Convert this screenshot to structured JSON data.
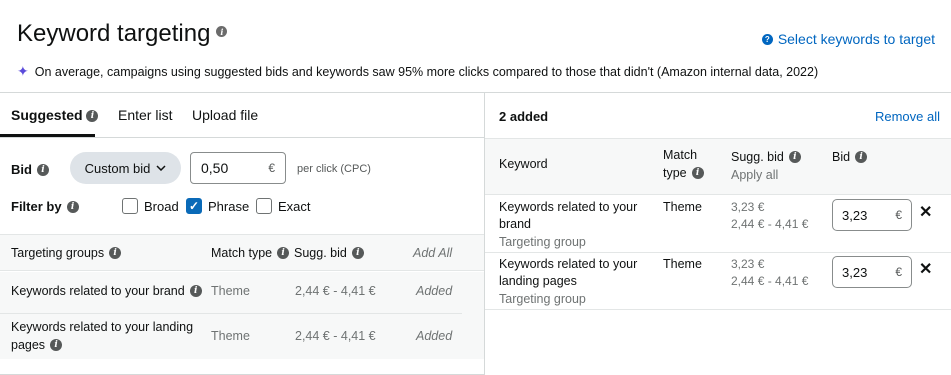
{
  "header": {
    "title": "Keyword targeting",
    "select_link": "Select keywords to target",
    "notice": "On average, campaigns using suggested bids and keywords saw 95% more clicks compared to those that didn't (Amazon internal data, 2022)"
  },
  "tabs": [
    {
      "label": "Suggested"
    },
    {
      "label": "Enter list"
    },
    {
      "label": "Upload file"
    }
  ],
  "bid": {
    "label": "Bid",
    "dropdown": "Custom bid",
    "value": "0,50",
    "currency": "€",
    "per_click": "per click (CPC)"
  },
  "filter": {
    "label": "Filter by",
    "options": [
      {
        "label": "Broad",
        "checked": false
      },
      {
        "label": "Phrase",
        "checked": true
      },
      {
        "label": "Exact",
        "checked": false
      }
    ]
  },
  "targeting_table": {
    "headers": {
      "group": "Targeting groups",
      "match": "Match type",
      "sugg": "Sugg. bid",
      "add_all": "Add All"
    },
    "rows": [
      {
        "name": "Keywords related to your brand",
        "match": "Theme",
        "sugg": "2,44 € - 4,41 €",
        "status": "Added"
      },
      {
        "name_line1": "Keywords related to your landing",
        "name_line2": "pages",
        "match": "Theme",
        "sugg": "2,44 € - 4,41 €",
        "status": "Added"
      }
    ]
  },
  "added_panel": {
    "title": "2 added",
    "remove_all": "Remove all",
    "headers": {
      "keyword": "Keyword",
      "match_line1": "Match",
      "match_line2": "type",
      "sugg": "Sugg. bid",
      "apply_all": "Apply all",
      "bid": "Bid"
    },
    "rows": [
      {
        "kw1": "Keywords related to your",
        "kw2": "brand",
        "sub": "Targeting group",
        "match": "Theme",
        "sugg": "3,23 €",
        "range": "2,44 € - 4,41 €",
        "bid": "3,23",
        "currency": "€"
      },
      {
        "kw1": "Keywords related to your",
        "kw2": "landing pages",
        "sub": "Targeting group",
        "match": "Theme",
        "sugg": "3,23 €",
        "range": "2,44 € - 4,41 €",
        "bid": "3,23",
        "currency": "€"
      }
    ]
  }
}
